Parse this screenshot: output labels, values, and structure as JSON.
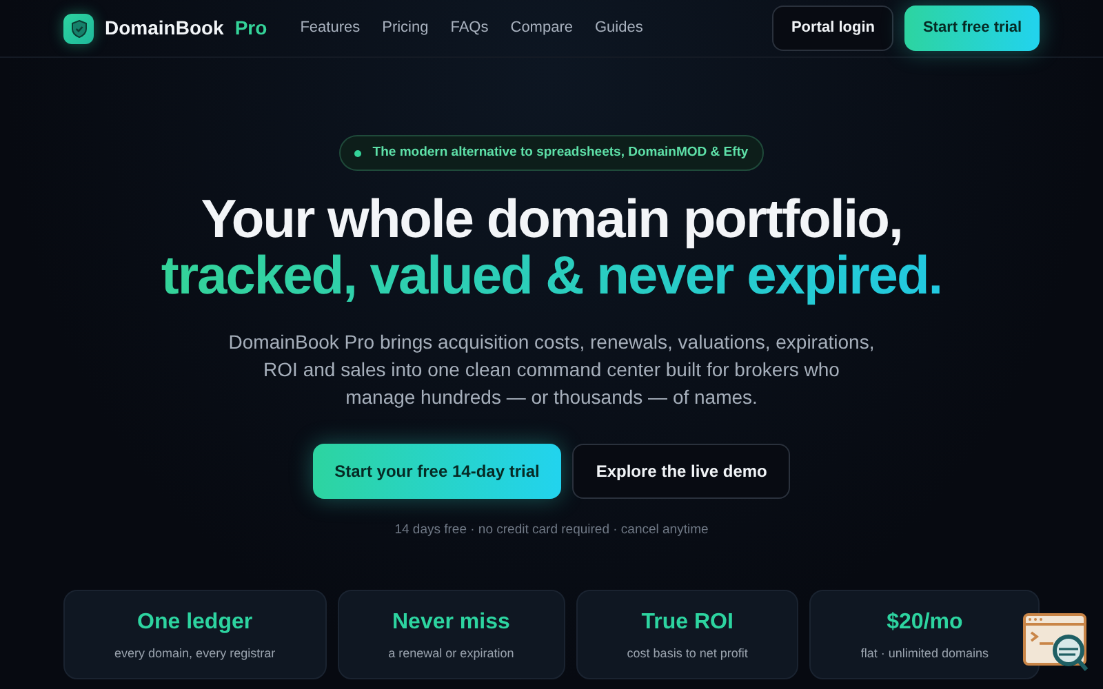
{
  "brand": {
    "name": "DomainBook",
    "suffix": "Pro"
  },
  "nav": [
    "Features",
    "Pricing",
    "FAQs",
    "Compare",
    "Guides"
  ],
  "header_buttons": [
    {
      "label": "Portal login",
      "kind": "outline"
    },
    {
      "label": "Start free trial",
      "kind": "primary"
    }
  ],
  "hero": {
    "badge": "The modern alternative to spreadsheets, DomainMOD & Efty",
    "title_lines": [
      "Your whole domain portfolio,",
      "tracked, valued & never expired."
    ],
    "description": "DomainBook Pro brings acquisition costs, renewals, valuations, expirations, ROI and sales into one clean command center built for brokers who manage hundreds — or thousands — of names.",
    "buttons": [
      {
        "label": "Start your free 14-day trial",
        "kind": "primary"
      },
      {
        "label": "Explore the live demo",
        "kind": "outline"
      }
    ],
    "note": "14 days free · no credit card required · cancel anytime"
  },
  "stats": [
    {
      "title": "One ledger",
      "subtitle": "every domain, every registrar"
    },
    {
      "title": "Never miss",
      "subtitle": "a renewal or expiration"
    },
    {
      "title": "True ROI",
      "subtitle": "cost basis to net profit"
    },
    {
      "title": "$20/mo",
      "subtitle": "flat · unlimited domains"
    }
  ]
}
